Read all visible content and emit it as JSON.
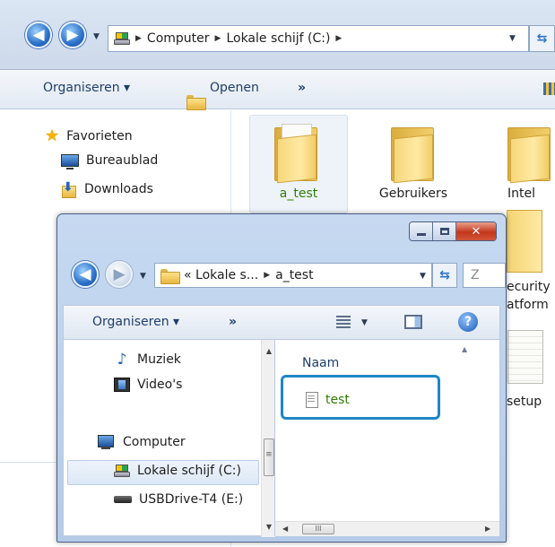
{
  "back_window": {
    "breadcrumb": [
      "Computer",
      "Lokale schijf (C:)"
    ],
    "toolbar": {
      "organize_label": "Organiseren ▾",
      "open_label": "Openen",
      "more_label": "»"
    },
    "nav": {
      "favorites_label": "Favorieten",
      "items": [
        {
          "label": "Bureaublad",
          "icon": "desktop-icon"
        },
        {
          "label": "Downloads",
          "icon": "downloads-icon"
        }
      ]
    },
    "content": {
      "items": [
        {
          "label": "a_test",
          "selected": true,
          "icon": "folder-icon"
        },
        {
          "label": "Gebruikers",
          "selected": false,
          "icon": "folder-icon"
        },
        {
          "label": "Intel",
          "selected": false,
          "icon": "folder-icon"
        }
      ],
      "partial_labels": [
        "ecurity",
        "atform",
        "setup"
      ]
    }
  },
  "front_window": {
    "breadcrumb": [
      "« Lokale s...",
      "a_test"
    ],
    "search_placeholder": "Z",
    "toolbar": {
      "organize_label": "Organiseren ▾",
      "more_label": "»"
    },
    "nav": {
      "items": [
        {
          "label": "Muziek",
          "icon": "music-icon"
        },
        {
          "label": "Video's",
          "icon": "video-icon"
        },
        {
          "label": "Computer",
          "icon": "computer-icon"
        },
        {
          "label": "Lokale schijf (C:)",
          "icon": "drive-icon",
          "selected": true
        },
        {
          "label": "USBDrive-T4 (E:)",
          "icon": "usb-drive-icon"
        }
      ]
    },
    "content": {
      "column_header": "Naam",
      "files": [
        {
          "label": "test",
          "icon": "text-file-icon"
        }
      ]
    }
  },
  "colors": {
    "highlight": "#1f86c7",
    "file_label": "#2f7d00",
    "nav_accent": "#1e3d6b"
  }
}
